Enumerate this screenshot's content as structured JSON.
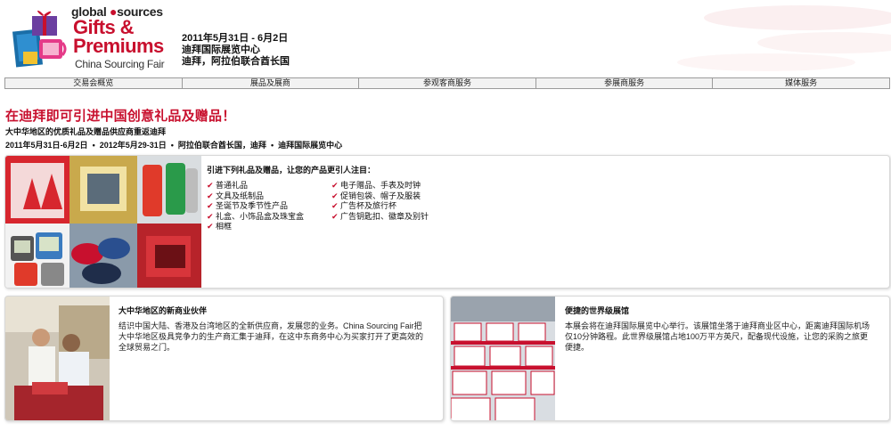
{
  "brand": {
    "line1_a": "global",
    "line1_b": "sources",
    "main_line1": "Gifts &",
    "main_line2": "Premiums",
    "fair": "China Sourcing Fair"
  },
  "event": {
    "dates": "2011年5月31日 - 6月2日",
    "venue": "迪拜国际展览中心",
    "location": "迪拜，阿拉伯联合酋长国"
  },
  "nav": [
    "交易会概览",
    "展品及展商",
    "参观客商服务",
    "参展商服务",
    "媒体服务"
  ],
  "intro": {
    "headline": "在迪拜即可引进中国创意礼品及赠品！",
    "subhead": "大中华地区的优质礼品及赠品供应商重返迪拜",
    "date1": "2011年5月31日-6月2日",
    "date2": "2012年5月29-31日",
    "place1": "阿拉伯联合酋长国，迪拜",
    "place2": "迪拜国际展览中心",
    "bullet": "•"
  },
  "products": {
    "title": "引进下列礼品及赠品，让您的产品更引人注目：",
    "col1": [
      "普通礼品",
      "文具及纸制品",
      "圣诞节及季节性产品",
      "礼盒、小饰品盒及珠宝盒",
      "相框"
    ],
    "col2": [
      "电子赠品、手表及时钟",
      "促销包袋、帽子及服装",
      "广告杯及旅行杯",
      "广告钥匙扣、徽章及别针"
    ],
    "check": "✔"
  },
  "partners": {
    "title": "大中华地区的新商业伙伴",
    "text": "结识中国大陆、香港及台湾地区的全新供应商，发展您的业务。China Sourcing Fair把大中华地区极具竞争力的生产商汇集于迪拜，在这中东商务中心为买家打开了更高效的全球贸易之门。"
  },
  "venue": {
    "title": "便捷的世界级展馆",
    "text": "本展会将在迪拜国际展览中心举行。该展馆坐落于迪拜商业区中心，距离迪拜国际机场仅10分钟路程。此世界级展馆占地100万平方英尺，配备现代设施，让您的采购之旅更便捷。"
  },
  "colors": {
    "brand_red": "#c8102e",
    "nav_bg": "#f2f2f2",
    "nav_border": "#9a9a9a"
  },
  "icons": {
    "logo": "gift-box-logo-icon",
    "check": "check-icon"
  }
}
